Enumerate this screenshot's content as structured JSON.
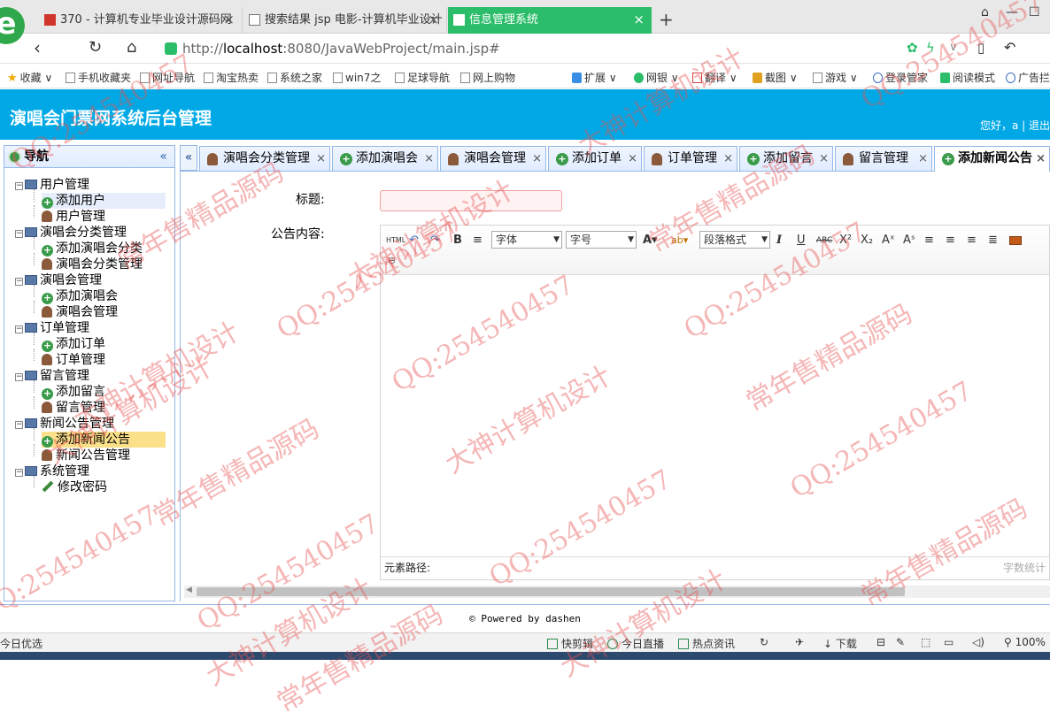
{
  "browser": {
    "tabs": [
      {
        "label": "370 - 计算机专业毕业设计源码网",
        "color": "#d0362b"
      },
      {
        "label": "搜索结果 jsp 电影-计算机毕业设计"
      },
      {
        "label": "信息管理系统",
        "active": true
      }
    ],
    "new_tab": "+",
    "url_prefix": "http://",
    "url_host": "localhost",
    "url_rest": ":8080/JavaWebProject/main.jsp#",
    "bookmarks": [
      "收藏",
      "手机收藏夹",
      "网址导航",
      "淘宝热卖",
      "系统之家",
      "win7之",
      "足球导航",
      "网上购物",
      "扩展",
      "网银",
      "翻译",
      "截图",
      "游戏",
      "登录管家",
      "阅读模式",
      "广告拦"
    ]
  },
  "app": {
    "title": "演唱会门票网系统后台管理",
    "greeting": "您好，a | 退出"
  },
  "nav": {
    "header": "导航",
    "collapse": "«",
    "tree": [
      {
        "label": "用户管理",
        "type": "group"
      },
      {
        "label": "添加用户",
        "type": "add"
      },
      {
        "label": "用户管理",
        "type": "user"
      },
      {
        "label": "演唱会分类管理",
        "type": "group"
      },
      {
        "label": "添加演唱会分类",
        "type": "add"
      },
      {
        "label": "演唱会分类管理",
        "type": "user"
      },
      {
        "label": "演唱会管理",
        "type": "group"
      },
      {
        "label": "添加演唱会",
        "type": "add"
      },
      {
        "label": "演唱会管理",
        "type": "user"
      },
      {
        "label": "订单管理",
        "type": "group"
      },
      {
        "label": "添加订单",
        "type": "add"
      },
      {
        "label": "订单管理",
        "type": "user"
      },
      {
        "label": "留言管理",
        "type": "group"
      },
      {
        "label": "添加留言",
        "type": "add"
      },
      {
        "label": "留言管理",
        "type": "user"
      },
      {
        "label": "新闻公告管理",
        "type": "group"
      },
      {
        "label": "添加新闻公告",
        "type": "add",
        "selected": true
      },
      {
        "label": "新闻公告管理",
        "type": "user"
      },
      {
        "label": "系统管理",
        "type": "group"
      },
      {
        "label": "修改密码",
        "type": "pen"
      }
    ]
  },
  "tabs": [
    {
      "label": "演唱会分类管理",
      "icon": "user"
    },
    {
      "label": "添加演唱会",
      "icon": "add"
    },
    {
      "label": "演唱会管理",
      "icon": "user"
    },
    {
      "label": "添加订单",
      "icon": "add"
    },
    {
      "label": "订单管理",
      "icon": "user"
    },
    {
      "label": "添加留言",
      "icon": "add"
    },
    {
      "label": "留言管理",
      "icon": "user"
    },
    {
      "label": "添加新闻公告",
      "icon": "add",
      "active": true
    }
  ],
  "form": {
    "title_label": "标题:",
    "title_value": "",
    "content_label": "公告内容:"
  },
  "editor": {
    "html_btn": "HTML",
    "font_select": "字体",
    "size_select": "字号",
    "para_select": "段落格式",
    "footer_path": "元素路径:",
    "word_count": "字数统计"
  },
  "footer": "© Powered by dashen",
  "status": {
    "left": "今日优选",
    "items": [
      "快剪辑",
      "今日直播",
      "热点资讯",
      "下载",
      "100%"
    ]
  },
  "watermarks": [
    "QQ:254540457",
    "常年售精品源码",
    "大神计算机设计"
  ]
}
